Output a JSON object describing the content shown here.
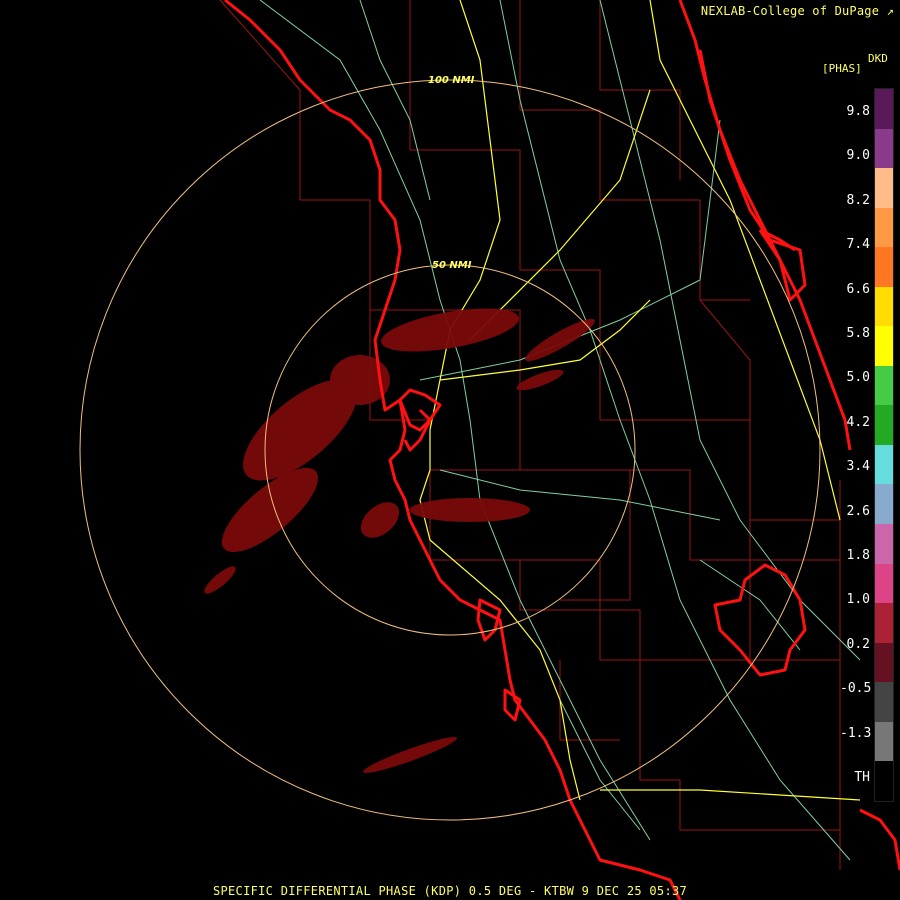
{
  "credit": "NEXLAB-College of DuPage",
  "credit_icon": "cursor-icon",
  "legend": {
    "title": "[PHAS]",
    "units": "DKD",
    "ticks": [
      "9.8",
      "9.0",
      "8.2",
      "7.4",
      "6.6",
      "5.8",
      "5.0",
      "4.2",
      "3.4",
      "2.6",
      "1.8",
      "1.0",
      "0.2",
      "-0.5",
      "-1.3",
      "TH"
    ],
    "colors": [
      "#5a1a5a",
      "#8a3a8a",
      "#ffbb88",
      "#ff9944",
      "#ff7722",
      "#ffdd00",
      "#ffff00",
      "#44cc44",
      "#22aa22",
      "#66dddd",
      "#88aacc",
      "#cc66aa",
      "#dd4488",
      "#aa2233",
      "#661122",
      "#444444",
      "#777777",
      "#000000"
    ]
  },
  "range_rings": [
    {
      "label": "100 NMI"
    },
    {
      "label": "50 NMI"
    }
  ],
  "footer": "SPECIFIC DIFFERENTIAL PHASE (KDP) 0.5 DEG - KTBW 9 DEC 25 05:37",
  "colors": {
    "coast": "#ff0000",
    "county": "#aa1111",
    "highway_major": "#ffff33",
    "highway_minor": "#88ddaa",
    "ring": "#ffcc88",
    "echo": "#7a0a0a"
  }
}
